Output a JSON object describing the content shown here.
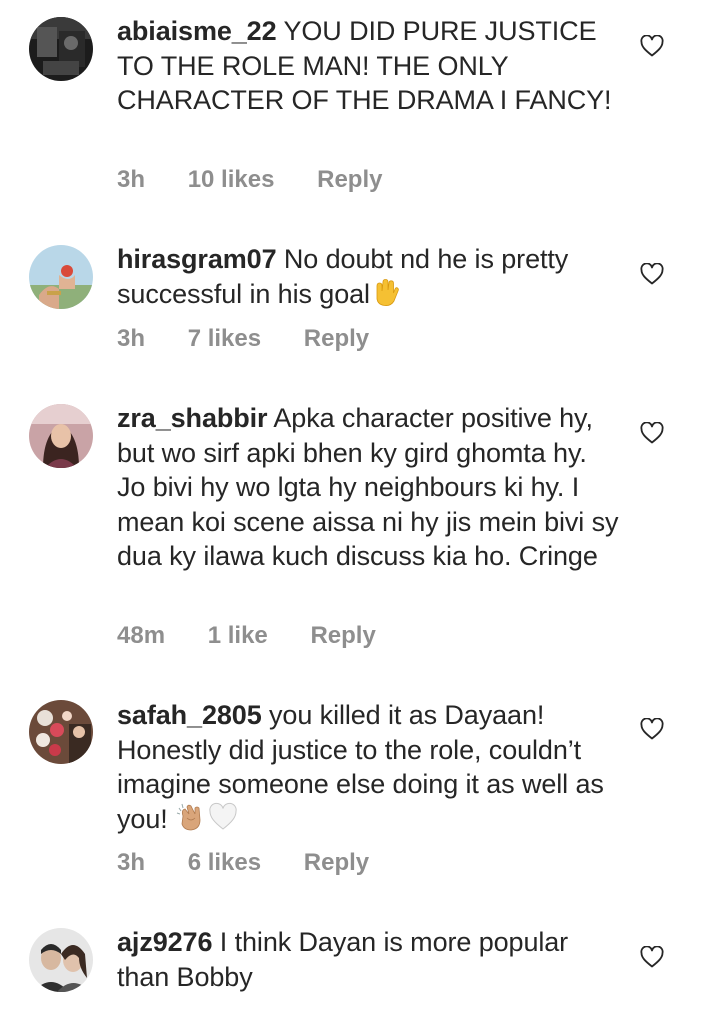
{
  "comments": [
    {
      "username": "abiaisme_22",
      "text": "YOU DID PURE JUSTICE TO THE ROLE MAN! THE ONLY CHARACTER OF THE DRAMA I FANCY!",
      "time": "3h",
      "likes": "10 likes",
      "reply": "Reply",
      "avatar_icon": "avatar-dark-photo",
      "like_icon": "heart-outline-icon"
    },
    {
      "username": "hirasgram07",
      "text": "No doubt nd he is pretty successful in his goal",
      "emoji": "waving-hand-emoji",
      "time": "3h",
      "likes": "7 likes",
      "reply": "Reply",
      "avatar_icon": "avatar-sky-hand-photo",
      "like_icon": "heart-outline-icon"
    },
    {
      "username": "zra_shabbir",
      "text": "Apka character positive hy, but wo sirf apki bhen ky gird ghomta hy. Jo bivi hy wo lgta hy neighbours ki hy. I mean koi scene aissa ni hy jis mein bivi sy dua ky ilawa kuch discuss kia ho. Cringe",
      "time": "48m",
      "likes": "1 like",
      "reply": "Reply",
      "avatar_icon": "avatar-portrait-photo",
      "like_icon": "heart-outline-icon"
    },
    {
      "username": "safah_2805",
      "text": "you killed it as Dayaan! Honestly did justice to the role, couldn’t imagine someone else doing it as well as you!",
      "emoji": "clapping-hands-emoji",
      "emoji2": "white-heart-emoji",
      "time": "3h",
      "likes": "6 likes",
      "reply": "Reply",
      "avatar_icon": "avatar-flowers-photo",
      "like_icon": "heart-outline-icon"
    },
    {
      "username": "ajz9276",
      "text": "I think Dayan is more popular than Bobby",
      "avatar_icon": "avatar-couple-photo",
      "like_icon": "heart-outline-icon"
    }
  ],
  "colors": {
    "text": "#262626",
    "meta": "#8e8e8e",
    "background": "#ffffff"
  }
}
